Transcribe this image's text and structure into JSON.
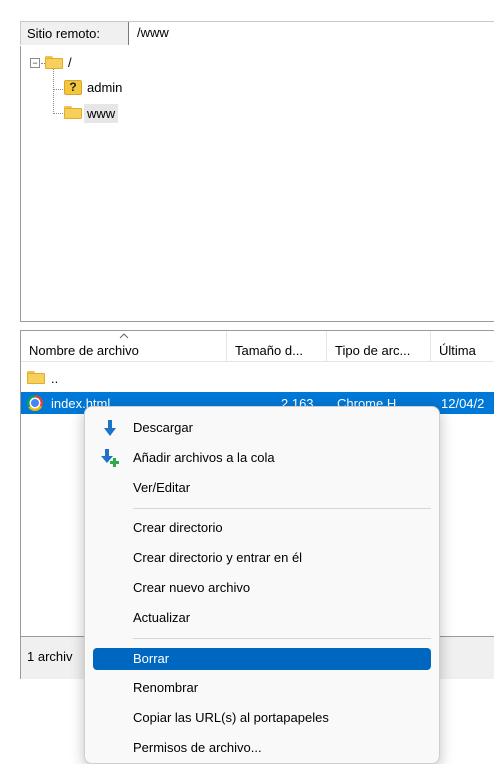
{
  "remote_bar": {
    "label": "Sitio remoto:",
    "path": "/www"
  },
  "tree": {
    "root": {
      "label": "/"
    },
    "children": [
      {
        "label": "admin",
        "icon": "question-folder-icon"
      },
      {
        "label": "www",
        "icon": "folder-icon",
        "selected": true
      }
    ]
  },
  "file_list": {
    "columns": [
      "Nombre de archivo",
      "Tamaño d...",
      "Tipo de arc...",
      "Última"
    ],
    "rows": [
      {
        "name": "..",
        "size": "",
        "type": "",
        "modified": "",
        "icon": "folder-icon"
      },
      {
        "name": "index.html",
        "size": "2.163",
        "type": "Chrome H",
        "modified": "12/04/2",
        "icon": "chrome-icon",
        "selected": true
      }
    ]
  },
  "status": {
    "text": "1 archiv"
  },
  "context_menu": {
    "items": [
      {
        "label": "Descargar",
        "icon": "download-arrow-icon"
      },
      {
        "label": "Añadir archivos a la cola",
        "icon": "add-to-queue-icon"
      },
      {
        "label": "Ver/Editar"
      },
      {
        "separator": true
      },
      {
        "label": "Crear directorio"
      },
      {
        "label": "Crear directorio y entrar en él"
      },
      {
        "label": "Crear nuevo archivo"
      },
      {
        "label": "Actualizar"
      },
      {
        "separator": true
      },
      {
        "label": "Borrar",
        "highlighted": true
      },
      {
        "label": "Renombrar"
      },
      {
        "label": "Copiar las URL(s) al portapapeles"
      },
      {
        "label": "Permisos de archivo..."
      }
    ]
  },
  "colors": {
    "selection": "#0078d7",
    "menu_highlight": "#0067c0",
    "download_blue": "#1e72c8",
    "add_green": "#2fa84f"
  }
}
